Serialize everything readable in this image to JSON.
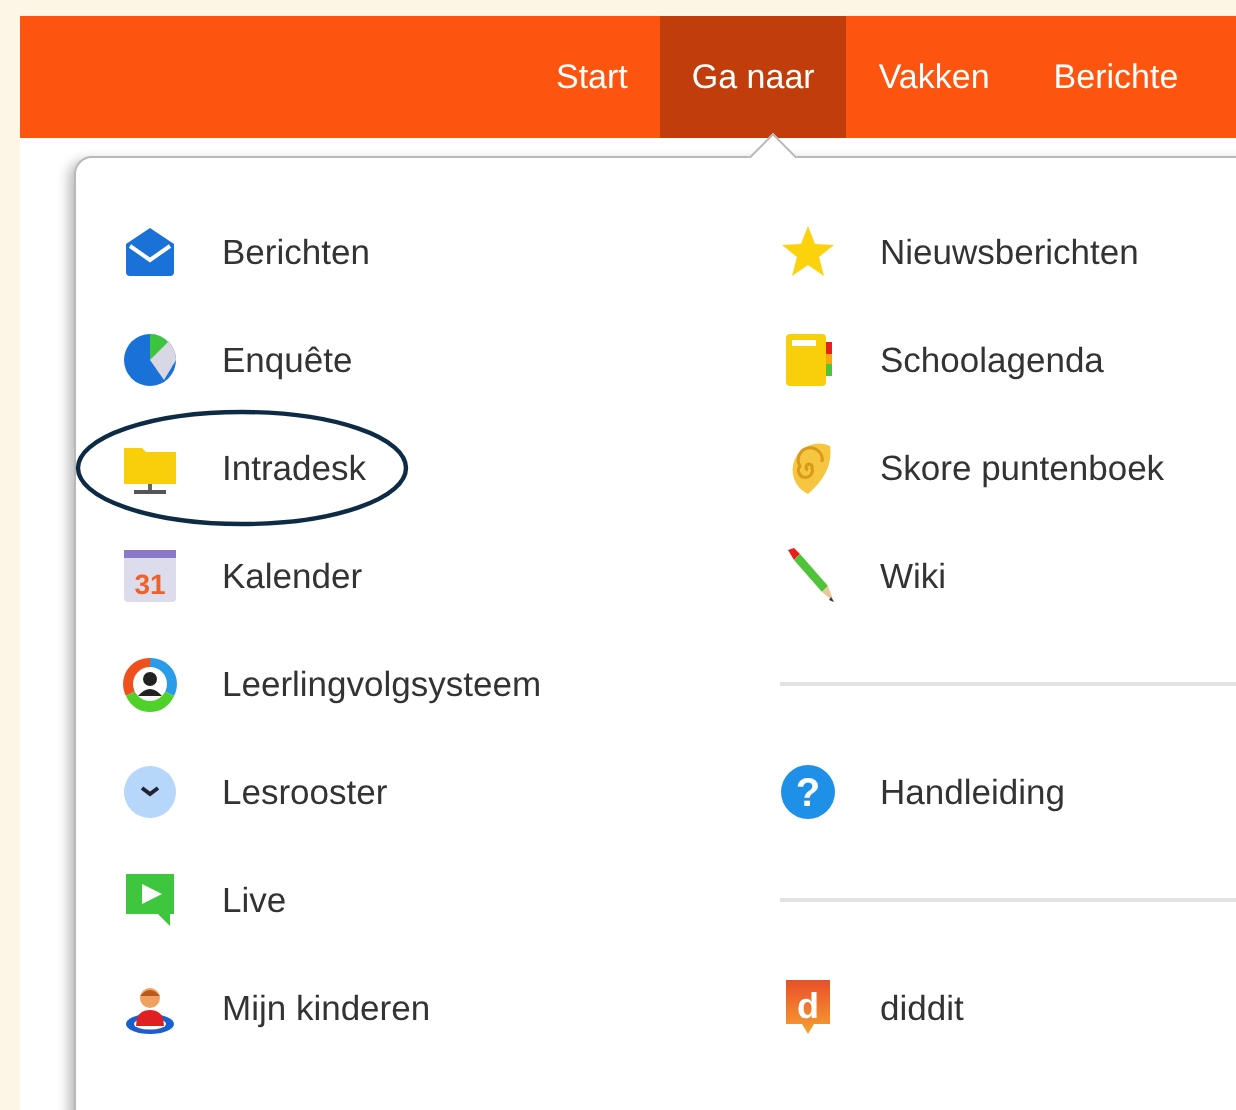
{
  "nav": [
    {
      "label": "Start",
      "selected": false
    },
    {
      "label": "Ga naar",
      "selected": true
    },
    {
      "label": "Vakken",
      "selected": false
    },
    {
      "label": "Berichte",
      "selected": false
    }
  ],
  "menu": {
    "left_column": [
      {
        "kind": "link",
        "label": "Berichten",
        "highlighted": false
      },
      {
        "kind": "link",
        "label": "Enquête",
        "highlighted": false
      },
      {
        "kind": "link",
        "label": "Intradesk",
        "highlighted": true
      },
      {
        "kind": "link",
        "label": "Kalender",
        "highlighted": false,
        "icon_text": "31"
      },
      {
        "kind": "link",
        "label": "Leerlingvolgsysteem",
        "highlighted": false
      },
      {
        "kind": "link",
        "label": "Lesrooster",
        "highlighted": false
      },
      {
        "kind": "link",
        "label": "Live",
        "highlighted": false
      },
      {
        "kind": "link",
        "label": "Mijn kinderen",
        "highlighted": false
      }
    ],
    "right_column": [
      {
        "kind": "link",
        "label": "Nieuwsberichten"
      },
      {
        "kind": "link",
        "label": "Schoolagenda"
      },
      {
        "kind": "link",
        "label": "Skore puntenboek"
      },
      {
        "kind": "link",
        "label": "Wiki"
      },
      {
        "kind": "divider"
      },
      {
        "kind": "link",
        "label": "Handleiding",
        "icon_text": "?"
      },
      {
        "kind": "divider"
      },
      {
        "kind": "link",
        "label": "diddit",
        "icon_text": "d"
      }
    ]
  }
}
